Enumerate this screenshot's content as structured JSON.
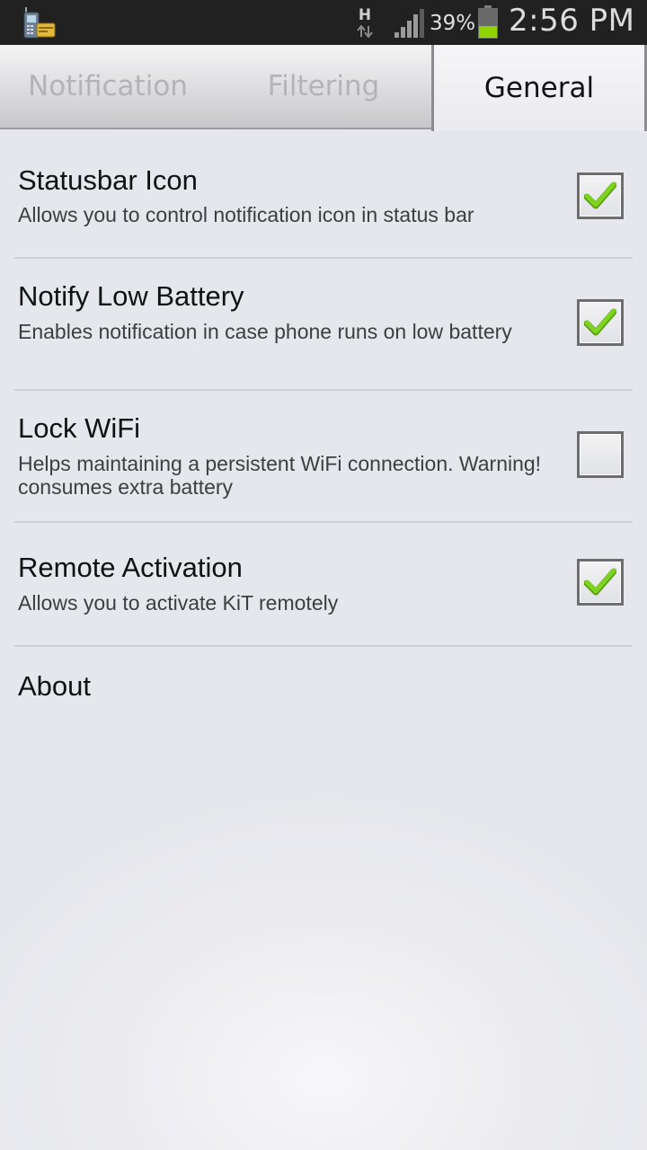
{
  "status_bar": {
    "app_icon": "kit-app-icon",
    "network_type": "H",
    "network_arrows_icon": "data-transfer-arrows-icon",
    "signal_icon": "signal-strength-icon",
    "battery_percent": "39%",
    "battery_icon": "battery-icon",
    "battery_level": 0.39,
    "battery_color": "#8fd400",
    "time": "2:56 PM"
  },
  "tabs": [
    {
      "label": "Notification",
      "active": false
    },
    {
      "label": "Filtering",
      "active": false
    },
    {
      "label": "General",
      "active": true
    }
  ],
  "preferences": [
    {
      "title": "Statusbar Icon",
      "summary": "Allows you to control notification icon in status bar",
      "checked": true
    },
    {
      "title": "Notify Low Battery",
      "summary": "Enables notification in case phone runs on low battery",
      "checked": true
    },
    {
      "title": "Lock WiFi",
      "summary": "Helps maintaining a persistent WiFi connection. Warning! consumes extra battery",
      "checked": false
    },
    {
      "title": "Remote Activation",
      "summary": "Allows you to activate KiT remotely",
      "checked": true
    },
    {
      "title": "About"
    }
  ],
  "colors": {
    "checkmark": "#7ed321",
    "status_bar_bg": "#212121",
    "active_tab_text": "#111111",
    "inactive_tab_text": "#b4b4b8"
  }
}
